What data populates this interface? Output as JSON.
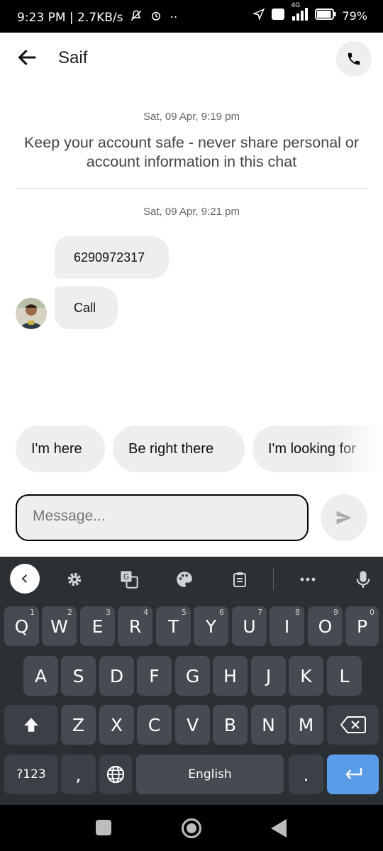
{
  "status_bar": {
    "time_speed": "9:23 PM | 2.7KB/s",
    "dots": "··",
    "network": "4G",
    "battery": "79%"
  },
  "header": {
    "contact_name": "Saif"
  },
  "chat": {
    "timestamp_1": "Sat, 09 Apr, 9:19 pm",
    "safety_notice": "Keep your account safe - never share personal or account information in this chat",
    "timestamp_2": "Sat, 09 Apr, 9:21 pm",
    "messages": [
      {
        "text": "6290972317"
      },
      {
        "text": "Call"
      }
    ]
  },
  "quick_replies": [
    "I'm here",
    "Be right there",
    "I'm looking for"
  ],
  "composer": {
    "placeholder": "Message..."
  },
  "keyboard": {
    "row1": [
      {
        "key": "Q",
        "hint": "1"
      },
      {
        "key": "W",
        "hint": "2"
      },
      {
        "key": "E",
        "hint": "3"
      },
      {
        "key": "R",
        "hint": "4"
      },
      {
        "key": "T",
        "hint": "5"
      },
      {
        "key": "Y",
        "hint": "6"
      },
      {
        "key": "U",
        "hint": "7"
      },
      {
        "key": "I",
        "hint": "8"
      },
      {
        "key": "O",
        "hint": "9"
      },
      {
        "key": "P",
        "hint": "0"
      }
    ],
    "row2": [
      "A",
      "S",
      "D",
      "F",
      "G",
      "H",
      "J",
      "K",
      "L"
    ],
    "row3": [
      "Z",
      "X",
      "C",
      "V",
      "B",
      "N",
      "M"
    ],
    "symbols_label": "?123",
    "comma": ",",
    "space_label": "English",
    "period": "."
  },
  "icons": {
    "back": "arrow-left-icon",
    "call": "phone-icon",
    "send": "send-icon"
  },
  "colors": {
    "enter_key": "#5b9ce8",
    "keyboard_bg": "#2b3034",
    "bubble_bg": "#eeeeee"
  }
}
